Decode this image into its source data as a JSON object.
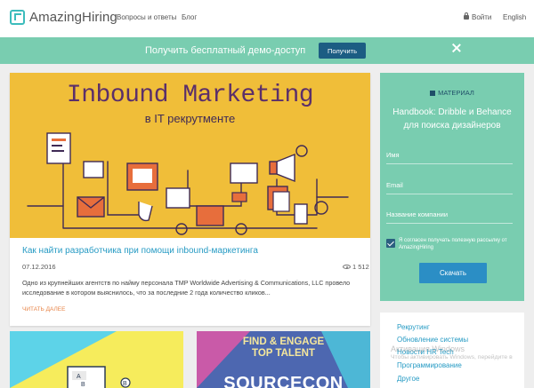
{
  "header": {
    "logo_text": "AmazingHiring",
    "nav": [
      "Вопросы и ответы",
      "Блог"
    ],
    "login": "Войти",
    "language": "English"
  },
  "banner": {
    "text": "Получить бесплатный демо-доступ",
    "button": "Получить"
  },
  "article": {
    "hero_title": "Inbound Marketing",
    "hero_subtitle": "в IT рекрутменте",
    "title": "Как найти разработчика при помощи inbound-маркетинга",
    "date": "07.12.2016",
    "views": "1 512",
    "excerpt": "Одно из крупнейших агентств по найму персонала TMP Worldwide Advertising & Communications, LLC провело исследование в котором выяснилось, что за последние 2 года количество кликов...",
    "read_more": "ЧИТАТЬ ДАЛЕЕ"
  },
  "thumbs": {
    "second_top": "FIND & ENGAGE\nTOP TALENT",
    "second_big": "SOURCECON"
  },
  "sidebar": {
    "tag": "МАТЕРИАЛ",
    "title": "Handbook: Dribble и Behance для поиска дизайнеров",
    "fields": [
      "Имя",
      "Email",
      "Название компании"
    ],
    "consent": "Я согласен получать полезную рассылку от AmazingHiring",
    "submit": "Скачать",
    "links": [
      "Рекрутинг",
      "Обновление системы",
      "Новости HR Tech",
      "Программирование",
      "Другое"
    ]
  },
  "watermark": {
    "line1": "Активация Windows",
    "line2": "Чтобы активировать Windows, перейдите в"
  },
  "colors": {
    "accent": "#79cdb0",
    "primary_button": "#2b8ec5",
    "link": "#279bc4",
    "hero_bg": "#f0be39"
  }
}
